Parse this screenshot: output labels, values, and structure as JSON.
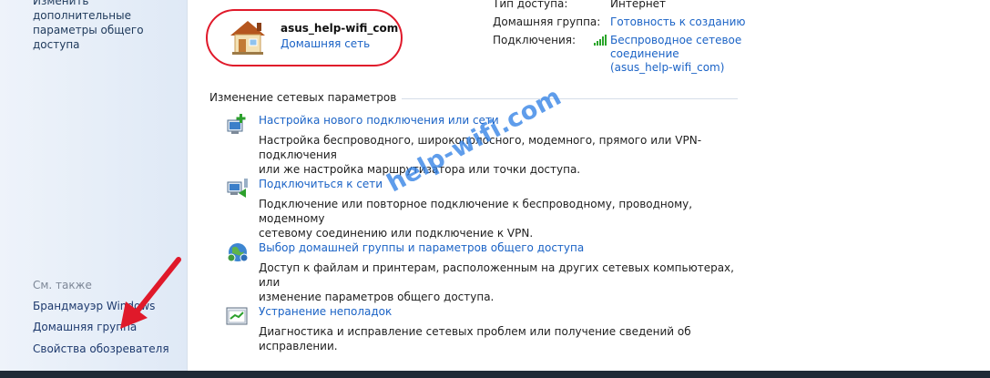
{
  "sidebar": {
    "top_link": "Изменить дополнительные параметры общего доступа",
    "see_also_title": "См. также",
    "see_also": [
      "Брандмауэр Windows",
      "Домашняя группа",
      "Свойства обозревателя"
    ]
  },
  "network": {
    "name": "asus_help-wifi_com",
    "type": "Домашняя сеть",
    "icon": "house-icon"
  },
  "access": {
    "access_type_label": "Тип доступа:",
    "access_type_value": "Интернет",
    "homegroup_label": "Домашняя группа:",
    "homegroup_value": "Готовность к созданию",
    "connections_label": "Подключения:",
    "connection_lines": [
      "Беспроводное сетевое",
      "соединение",
      "(asus_help-wifi_com)"
    ],
    "signal_icon": "wifi-signal-icon"
  },
  "section": {
    "title": "Изменение сетевых параметров"
  },
  "tasks": [
    {
      "title": "Настройка нового подключения или сети",
      "desc_lines": [
        "Настройка беспроводного, широкополосного, модемного, прямого или VPN-подключения",
        "или же настройка маршрутизатора или точки доступа."
      ],
      "icon": "new-connection-icon"
    },
    {
      "title": "Подключиться к сети",
      "desc_lines": [
        "Подключение или повторное подключение к беспроводному, проводному, модемному",
        "сетевому соединению или подключение к VPN."
      ],
      "icon": "connect-network-icon"
    },
    {
      "title": "Выбор домашней группы и параметров общего доступа",
      "desc_lines": [
        "Доступ к файлам и принтерам, расположенным на других сетевых компьютерах, или",
        "изменение параметров общего доступа."
      ],
      "icon": "homegroup-sharing-icon"
    },
    {
      "title": "Устранение неполадок",
      "desc_lines": [
        "Диагностика и исправление сетевых проблем или получение сведений об исправлении."
      ],
      "icon": "troubleshoot-icon"
    }
  ],
  "watermark": "help-wifi.com",
  "colors": {
    "link": "#1b63c6",
    "highlight": "#e0192a",
    "watermark": "#3282e6"
  }
}
